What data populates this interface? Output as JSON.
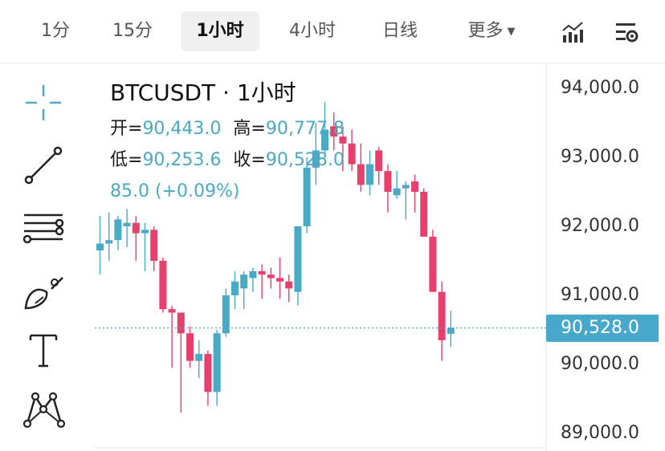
{
  "timeframes": {
    "t1m": "1分",
    "t15m": "15分",
    "t1h": "1小时",
    "t4h": "4小时",
    "t1d": "日线",
    "more": "更多"
  },
  "icons": [
    "indicator-chart-icon",
    "chart-settings-icon",
    "crosshair-icon",
    "trend-line-icon",
    "horizontal-lines-icon",
    "brush-icon",
    "text-tool-icon",
    "pattern-tool-icon"
  ],
  "colors": {
    "up": "#4aa9c4",
    "down": "#e8406c",
    "badge": "#47a8c9"
  },
  "chart": {
    "title": "BTCUSDT · 1小时",
    "open_label": "开=",
    "open": "90,443.0",
    "high_label": "高=",
    "high": "90,777.8",
    "low_label": "低=",
    "low": "90,253.6",
    "close_label": "收=",
    "close": "90,528.0",
    "change": "85.0 (+0.09%)",
    "last_price": "90,528.0"
  },
  "chart_data": {
    "type": "candlestick",
    "title": "BTCUSDT · 1小时",
    "interval": "1小时",
    "yaxis_ticks": [
      "94,000.0",
      "93,000.0",
      "92,000.0",
      "91,000.0",
      "90,000.0",
      "89,000.0"
    ],
    "ylim": [
      88700,
      94300
    ],
    "last_price": 90528.0,
    "last_ohlc": {
      "open": 90443.0,
      "high": 90777.8,
      "low": 90253.6,
      "close": 90528.0,
      "change": 85.0,
      "change_pct": 0.09
    },
    "candles": [
      {
        "o": 91650,
        "h": 92150,
        "l": 91300,
        "c": 91750
      },
      {
        "o": 91750,
        "h": 92200,
        "l": 91500,
        "c": 91800
      },
      {
        "o": 91800,
        "h": 92150,
        "l": 91650,
        "c": 92100
      },
      {
        "o": 92000,
        "h": 92250,
        "l": 91700,
        "c": 92050
      },
      {
        "o": 92050,
        "h": 92150,
        "l": 91500,
        "c": 91900
      },
      {
        "o": 91900,
        "h": 92050,
        "l": 91350,
        "c": 91950
      },
      {
        "o": 91950,
        "h": 92000,
        "l": 91350,
        "c": 91500
      },
      {
        "o": 91500,
        "h": 91550,
        "l": 90750,
        "c": 90800
      },
      {
        "o": 90800,
        "h": 90850,
        "l": 89950,
        "c": 90750
      },
      {
        "o": 90750,
        "h": 90750,
        "l": 89300,
        "c": 90450
      },
      {
        "o": 90450,
        "h": 90550,
        "l": 89950,
        "c": 90050
      },
      {
        "o": 90050,
        "h": 90350,
        "l": 89800,
        "c": 90150
      },
      {
        "o": 90150,
        "h": 90200,
        "l": 89400,
        "c": 89600
      },
      {
        "o": 89600,
        "h": 90500,
        "l": 89400,
        "c": 90450
      },
      {
        "o": 90450,
        "h": 91100,
        "l": 90400,
        "c": 91000
      },
      {
        "o": 91000,
        "h": 91350,
        "l": 90800,
        "c": 91200
      },
      {
        "o": 91100,
        "h": 91350,
        "l": 90800,
        "c": 91300
      },
      {
        "o": 91250,
        "h": 91400,
        "l": 91050,
        "c": 91350
      },
      {
        "o": 91350,
        "h": 91450,
        "l": 90950,
        "c": 91300
      },
      {
        "o": 91300,
        "h": 91400,
        "l": 91100,
        "c": 91250
      },
      {
        "o": 91250,
        "h": 91550,
        "l": 90950,
        "c": 91200
      },
      {
        "o": 91200,
        "h": 91300,
        "l": 90900,
        "c": 91100
      },
      {
        "o": 91050,
        "h": 92000,
        "l": 90850,
        "c": 92000
      },
      {
        "o": 92000,
        "h": 93000,
        "l": 91900,
        "c": 92850
      },
      {
        "o": 92850,
        "h": 93500,
        "l": 92600,
        "c": 93100
      },
      {
        "o": 93100,
        "h": 93800,
        "l": 93000,
        "c": 93400
      },
      {
        "o": 93450,
        "h": 93650,
        "l": 93100,
        "c": 93300
      },
      {
        "o": 93300,
        "h": 93450,
        "l": 92800,
        "c": 93200
      },
      {
        "o": 93200,
        "h": 93400,
        "l": 92800,
        "c": 92900
      },
      {
        "o": 92900,
        "h": 93200,
        "l": 92500,
        "c": 92600
      },
      {
        "o": 92600,
        "h": 93100,
        "l": 92450,
        "c": 92900
      },
      {
        "o": 93100,
        "h": 93150,
        "l": 92600,
        "c": 92800
      },
      {
        "o": 92800,
        "h": 92900,
        "l": 92200,
        "c": 92500
      },
      {
        "o": 92450,
        "h": 92800,
        "l": 92400,
        "c": 92550
      },
      {
        "o": 92550,
        "h": 92650,
        "l": 92100,
        "c": 92600
      },
      {
        "o": 92650,
        "h": 92750,
        "l": 92200,
        "c": 92500
      },
      {
        "o": 92500,
        "h": 92550,
        "l": 91850,
        "c": 91850
      },
      {
        "o": 91850,
        "h": 91950,
        "l": 91050,
        "c": 91050
      },
      {
        "o": 91050,
        "h": 91200,
        "l": 90050,
        "c": 90350
      },
      {
        "o": 90443,
        "h": 90777.8,
        "l": 90253.6,
        "c": 90528
      }
    ]
  }
}
